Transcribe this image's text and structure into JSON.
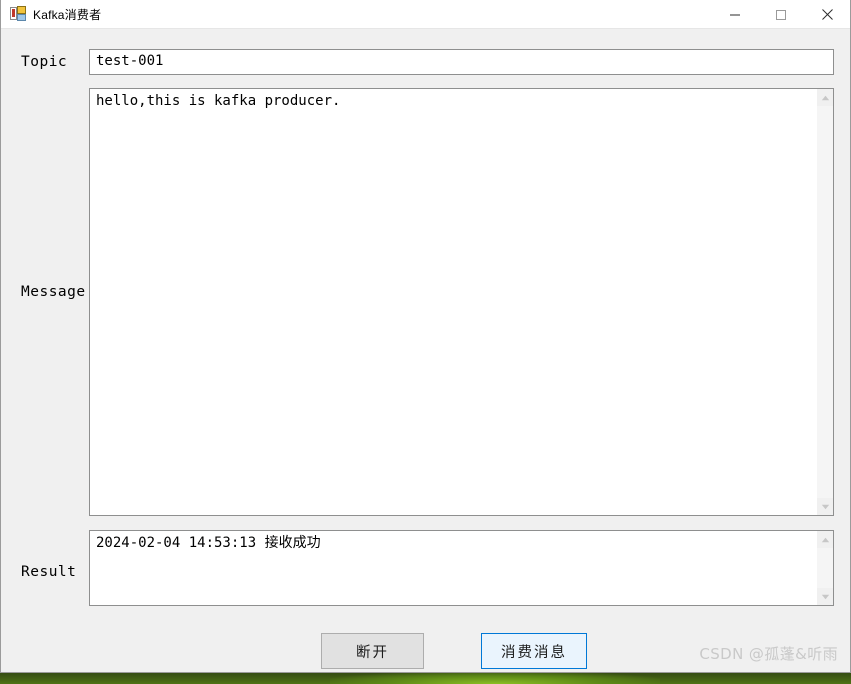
{
  "window": {
    "title": "Kafka消费者",
    "icon": "winforms-designer-icon",
    "controls": {
      "minimize": "minimize-icon",
      "maximize": "maximize-icon",
      "close": "close-icon"
    }
  },
  "form": {
    "topic": {
      "label": "Topic",
      "value": "test-001",
      "placeholder": ""
    },
    "message": {
      "label": "Message",
      "value": "hello,this is kafka producer.",
      "placeholder": ""
    },
    "result": {
      "label": "Result",
      "value": "2024-02-04 14:53:13 接收成功",
      "placeholder": ""
    }
  },
  "buttons": {
    "disconnect": "断开",
    "consume": "消费消息"
  },
  "scrollbars": {
    "up_arrow": "▲",
    "down_arrow": "▼"
  },
  "watermark": "CSDN @孤蓬&听雨",
  "colors": {
    "client_background": "#f0f0f0",
    "titlebar_background": "#ffffff",
    "field_background": "#ffffff",
    "field_border": "#8e8f8f",
    "accent_focus": "#0078d7",
    "accent_focus_fill": "#eaf4fd",
    "button_face": "#e1e1e1",
    "button_border": "#adadad",
    "watermark_text": "#c9c9c9"
  }
}
